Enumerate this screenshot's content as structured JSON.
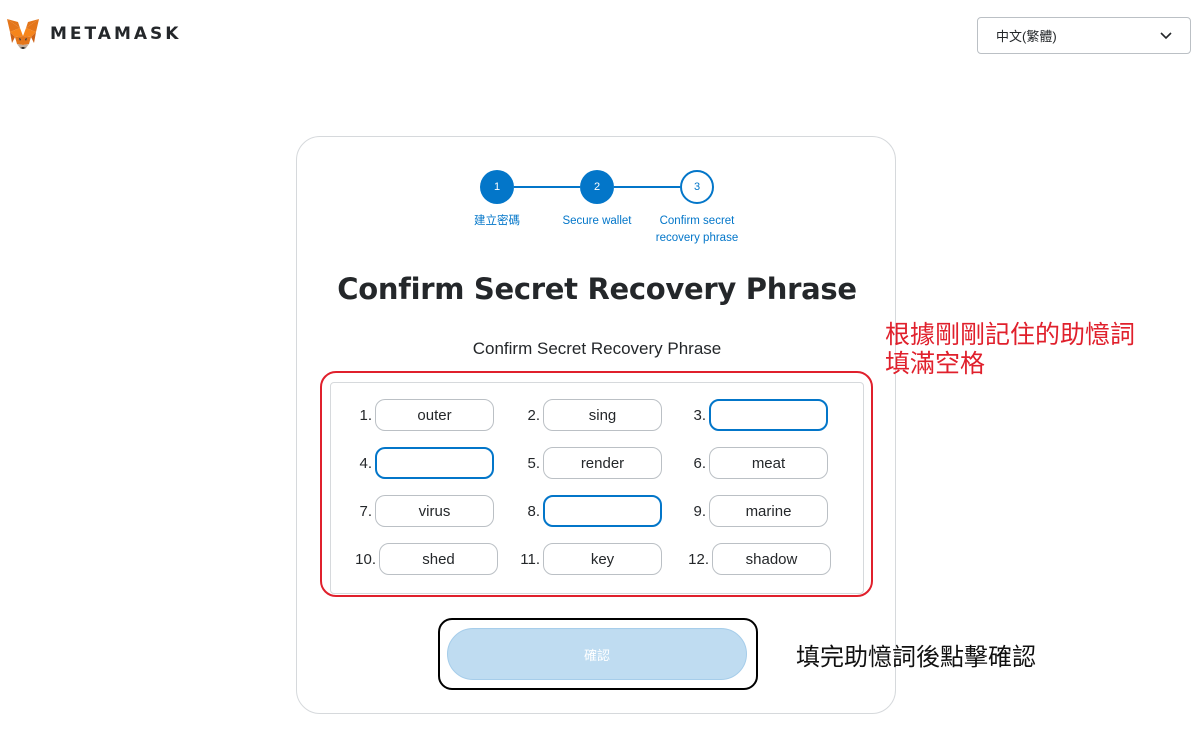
{
  "header": {
    "brand": "METAMASK",
    "language_selected": "中文(繁體)",
    "icons": {
      "logo": "metamask-fox-icon",
      "dropdown": "chevron-down-icon"
    }
  },
  "stepper": {
    "steps": [
      {
        "number": "1",
        "label": "建立密碼",
        "state": "completed"
      },
      {
        "number": "2",
        "label": "Secure wallet",
        "state": "completed"
      },
      {
        "number": "3",
        "label": "Confirm secret recovery phrase",
        "state": "current"
      }
    ]
  },
  "main": {
    "title": "Confirm Secret Recovery Phrase",
    "subtitle": "Confirm Secret Recovery Phrase",
    "words": [
      {
        "index": "1.",
        "word": "outer",
        "editable": false
      },
      {
        "index": "2.",
        "word": "sing",
        "editable": false
      },
      {
        "index": "3.",
        "word": "",
        "editable": true
      },
      {
        "index": "4.",
        "word": "",
        "editable": true
      },
      {
        "index": "5.",
        "word": "render",
        "editable": false
      },
      {
        "index": "6.",
        "word": "meat",
        "editable": false
      },
      {
        "index": "7.",
        "word": "virus",
        "editable": false
      },
      {
        "index": "8.",
        "word": "",
        "editable": true
      },
      {
        "index": "9.",
        "word": "marine",
        "editable": false
      },
      {
        "index": "10.",
        "word": "shed",
        "editable": false
      },
      {
        "index": "11.",
        "word": "key",
        "editable": false
      },
      {
        "index": "12.",
        "word": "shadow",
        "editable": false
      }
    ],
    "confirm_label": "確認"
  },
  "annotations": {
    "red_note_line1": "根據剛剛記住的助憶詞",
    "red_note_line2": "填滿空格",
    "black_note": "填完助憶詞後點擊確認"
  },
  "colors": {
    "primary": "#0376c9",
    "button_disabled": "#bfdcf1",
    "annotation_red": "#e0202c"
  }
}
